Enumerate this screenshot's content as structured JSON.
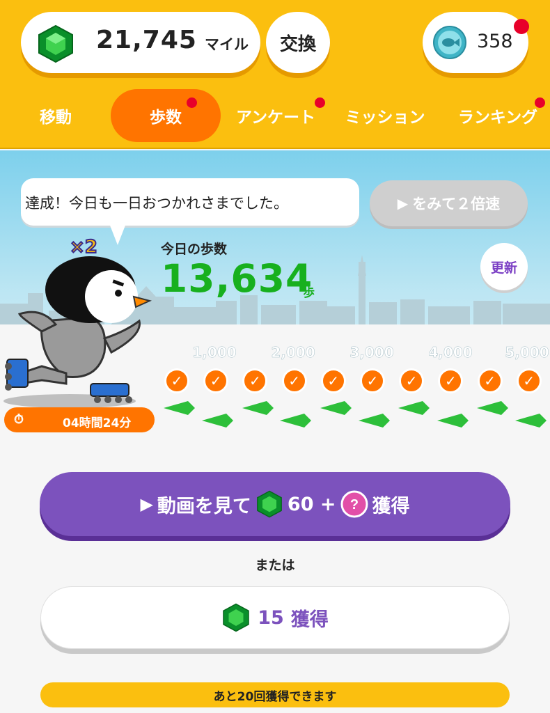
{
  "header": {
    "miles_value": "21,745",
    "miles_unit": "マイル",
    "exchange_label": "交換",
    "coin_value": "358",
    "gem_icon": "green-gem-icon",
    "coin_icon": "fish-coin-icon"
  },
  "tabs": [
    {
      "label": "移動",
      "active": false,
      "badge": false
    },
    {
      "label": "歩数",
      "active": true,
      "badge": true
    },
    {
      "label": "アンケート",
      "active": false,
      "badge": true
    },
    {
      "label": "ミッション",
      "active": false,
      "badge": false
    },
    {
      "label": "ランキング",
      "active": false,
      "badge": true
    }
  ],
  "scene": {
    "bubble_text": "達成！今日も一日おつかれさまでした。",
    "double_label": "をみて２倍速",
    "multiplier": "×2",
    "steps_label": "今日の歩数",
    "steps_value": "13,634",
    "steps_unit": "歩",
    "refresh_label": "更新",
    "milestones": [
      "1,000",
      "2,000",
      "3,000",
      "4,000",
      "5,000"
    ],
    "checks_count": 10,
    "timer": "04時間24分"
  },
  "actions": {
    "video_prefix": "動画を見て",
    "video_amount": "60 +",
    "video_suffix": "獲得",
    "or_text": "または",
    "earn_amount": "15",
    "earn_suffix": "獲得",
    "remaining": "あと20回獲得できます"
  },
  "colors": {
    "header": "#fbbf0f",
    "active_tab": "#ff7400",
    "steps_green": "#18b01e",
    "purple": "#7c52bd"
  }
}
